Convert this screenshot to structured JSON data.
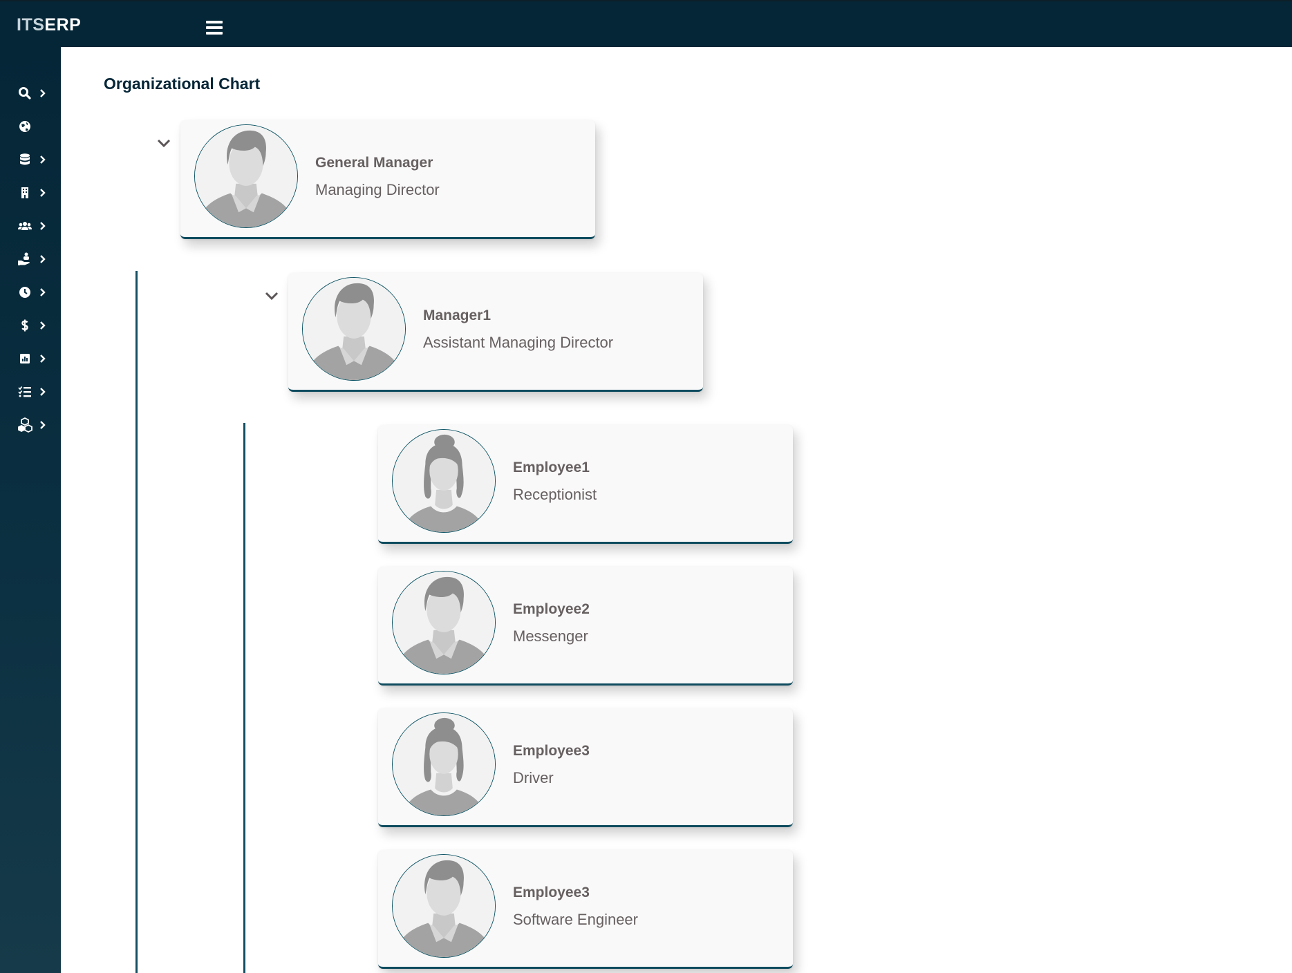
{
  "app": {
    "brand_part1": "ITS",
    "brand_part2": "ERP"
  },
  "sidebar": {
    "items": [
      {
        "icon": "search-icon",
        "has_submenu": true
      },
      {
        "icon": "globe-icon",
        "has_submenu": false
      },
      {
        "icon": "database-icon",
        "has_submenu": true
      },
      {
        "icon": "building-icon",
        "has_submenu": true
      },
      {
        "icon": "users-icon",
        "has_submenu": true
      },
      {
        "icon": "hand-holding-icon",
        "has_submenu": true
      },
      {
        "icon": "clock-icon",
        "has_submenu": true
      },
      {
        "icon": "dollar-icon",
        "has_submenu": true
      },
      {
        "icon": "chart-icon",
        "has_submenu": true
      },
      {
        "icon": "list-check-icon",
        "has_submenu": true
      },
      {
        "icon": "cubes-icon",
        "has_submenu": true
      }
    ]
  },
  "page": {
    "title": "Organizational Chart"
  },
  "org": {
    "general_manager": {
      "name": "General Manager",
      "title": "Managing Director",
      "avatar": "male"
    },
    "manager": {
      "name": "Manager1",
      "title": "Assistant Managing Director",
      "avatar": "male"
    },
    "employees": [
      {
        "name": "Employee1",
        "title": "Receptionist",
        "avatar": "female"
      },
      {
        "name": "Employee2",
        "title": "Messenger",
        "avatar": "male"
      },
      {
        "name": "Employee3",
        "title": "Driver",
        "avatar": "female"
      },
      {
        "name": "Employee3",
        "title": "Software Engineer",
        "avatar": "male"
      }
    ]
  },
  "colors": {
    "navy": "#052637",
    "accent": "#134e62",
    "text": "#676061",
    "card": "#f9f9f9"
  }
}
